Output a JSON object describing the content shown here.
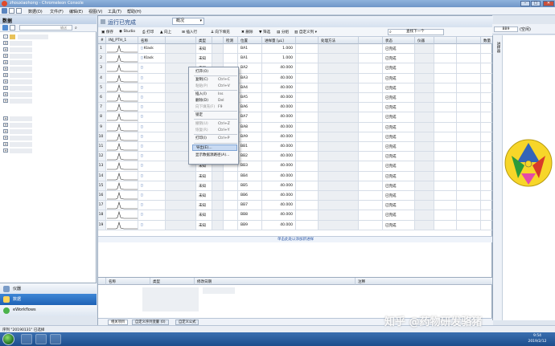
{
  "window": {
    "title": "zhouxiaohong - Chromeleon Console"
  },
  "menubar": {
    "items": [
      "数据(D)",
      "文件(F)",
      "编辑(E)",
      "视图(V)",
      "工具(T)",
      "帮助(H)"
    ]
  },
  "left_panel": {
    "title": "数据",
    "search_placeholder": "输送"
  },
  "left_nav": {
    "instrument": "仪器",
    "data": "数据",
    "workflows": "eWorkflows"
  },
  "main": {
    "title": "运行已完成",
    "status_value": "概况",
    "toolbar": {
      "save": "保存",
      "studio": "Studio",
      "print": "打印",
      "up": "向上",
      "insert_row": "插入行",
      "fill_down": "向下填充",
      "delete": "删除",
      "filter": "筛选",
      "group": "分组",
      "custom_columns": "自定义列",
      "find_next": "查找下一个"
    },
    "columns": [
      "#",
      "INJ_PTH_1",
      "名称",
      "",
      "类型",
      "",
      "检测",
      "位置",
      "进样量 [µL]",
      "",
      "处理方法",
      "",
      "状态",
      "仪器",
      "",
      "",
      "数量"
    ],
    "rows": [
      {
        "n": "1",
        "name": "Klask",
        "type": "未知",
        "pos": "BA1",
        "vol": "1.000",
        "status": "已完成",
        "qty": "1.0000"
      },
      {
        "n": "2",
        "name": "Klask",
        "type": "未知",
        "pos": "BA1",
        "vol": "1.000",
        "status": "已完成",
        "qty": "1.0000"
      },
      {
        "n": "3",
        "name": "",
        "type": "未知",
        "pos": "BA2",
        "vol": "40.000",
        "status": "已完成",
        "qty": "1.0000"
      },
      {
        "n": "4",
        "name": "",
        "type": "未知",
        "pos": "BA3",
        "vol": "40.000",
        "status": "已完成",
        "qty": "1.0000"
      },
      {
        "n": "5",
        "name": "",
        "type": "未知",
        "pos": "BA4",
        "vol": "40.000",
        "status": "已完成",
        "qty": "1.0000"
      },
      {
        "n": "6",
        "name": "",
        "type": "未知",
        "pos": "BA5",
        "vol": "40.000",
        "status": "已完成",
        "qty": "1.0000"
      },
      {
        "n": "7",
        "name": "",
        "type": "未知",
        "pos": "BA6",
        "vol": "40.000",
        "status": "已完成",
        "qty": "1.0000"
      },
      {
        "n": "8",
        "name": "",
        "type": "未知",
        "pos": "BA7",
        "vol": "40.000",
        "status": "已完成",
        "qty": "1.0000"
      },
      {
        "n": "9",
        "name": "",
        "type": "未知",
        "pos": "BA8",
        "vol": "40.000",
        "status": "已完成",
        "qty": "1.0000"
      },
      {
        "n": "10",
        "name": "",
        "type": "未知",
        "pos": "BA9",
        "vol": "40.000",
        "status": "已完成",
        "qty": "1.0000"
      },
      {
        "n": "11",
        "name": "",
        "type": "未知",
        "pos": "BB1",
        "vol": "40.000",
        "status": "已完成",
        "qty": "1.0000"
      },
      {
        "n": "12",
        "name": "",
        "type": "未知",
        "pos": "BB2",
        "vol": "40.000",
        "status": "已完成",
        "qty": "1.0000"
      },
      {
        "n": "13",
        "name": "",
        "type": "未知",
        "pos": "BB3",
        "vol": "40.000",
        "status": "已完成",
        "qty": "1.0000"
      },
      {
        "n": "14",
        "name": "",
        "type": "未知",
        "pos": "BB4",
        "vol": "40.000",
        "status": "已完成",
        "qty": "1.0000"
      },
      {
        "n": "15",
        "name": "",
        "type": "未知",
        "pos": "BB5",
        "vol": "40.000",
        "status": "已完成",
        "qty": "1.0000"
      },
      {
        "n": "16",
        "name": "",
        "type": "未知",
        "pos": "BB6",
        "vol": "40.000",
        "status": "已完成",
        "qty": "1.0000"
      },
      {
        "n": "17",
        "name": "",
        "type": "未知",
        "pos": "BB7",
        "vol": "40.000",
        "status": "已完成",
        "qty": "1.0000"
      },
      {
        "n": "18",
        "name": "",
        "type": "未知",
        "pos": "BB8",
        "vol": "40.000",
        "status": "已完成",
        "qty": "1.0000"
      },
      {
        "n": "19",
        "name": "",
        "type": "未知",
        "pos": "BB9",
        "vol": "40.000",
        "status": "已完成",
        "qty": "1.0000"
      }
    ],
    "footer_hint": "单击此处以添加新进样"
  },
  "context_menu": {
    "items": [
      {
        "label": "打开(O)",
        "shortcut": "",
        "disabled": false
      },
      {
        "label": "复制(C)",
        "shortcut": "Ctrl+C",
        "disabled": false
      },
      {
        "label": "粘贴(P)",
        "shortcut": "Ctrl+V",
        "disabled": true
      },
      {
        "label": "插入(I)",
        "shortcut": "Ins",
        "disabled": false
      },
      {
        "label": "删除(D)",
        "shortcut": "Del",
        "disabled": false
      },
      {
        "label": "向下填充(F)",
        "shortcut": "F9",
        "disabled": true
      },
      {
        "label": "锁定",
        "shortcut": "",
        "disabled": false
      },
      {
        "label": "撤销(U)",
        "shortcut": "Ctrl+Z",
        "disabled": true
      },
      {
        "label": "恢复(R)",
        "shortcut": "Ctrl+Y",
        "disabled": true
      },
      {
        "label": "打印(I)",
        "shortcut": "Ctrl+P",
        "disabled": false
      },
      {
        "label": "导出(E)...",
        "shortcut": "",
        "disabled": false
      },
      {
        "label": "显示数据源路径(A)...",
        "shortcut": "",
        "disabled": false
      }
    ]
  },
  "bottom_panel": {
    "columns": [
      "名称",
      "类型",
      "修改日期",
      "注释"
    ],
    "tabs": [
      "相关项目",
      "自定义序列变量 (0)",
      "自定义公式"
    ]
  },
  "right_panel": {
    "vertical_label": "进样器",
    "index_value": "BB9",
    "space_label": "(空闲)"
  },
  "statusbar": {
    "text": "序列 \"20190131\" 已选择"
  },
  "taskbar": {
    "time": "9:54",
    "date": "2019/2/12"
  },
  "watermark": "知乎 @药物研发骆猪",
  "colors": {
    "accent": "#1f62b5",
    "title_text": "#244a86",
    "highlight": "#c8daf2"
  }
}
